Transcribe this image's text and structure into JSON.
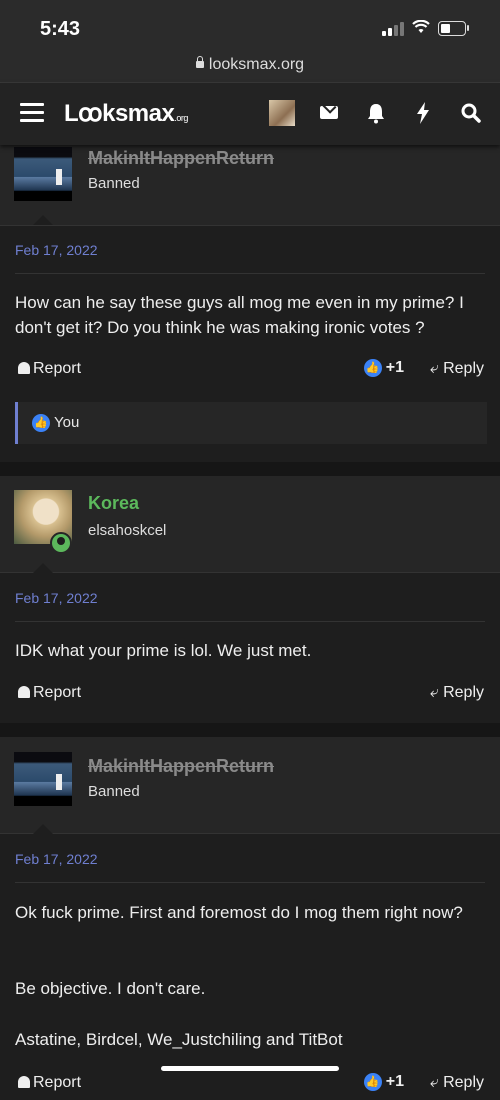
{
  "status": {
    "time": "5:43"
  },
  "browser": {
    "url": "looksmax.org"
  },
  "header": {
    "logo": "Lꝏksmax",
    "logo_suffix": ".org"
  },
  "posts": [
    {
      "username": "MakinItHappenReturn",
      "user_title": "Banned",
      "date": "Feb 17, 2022",
      "message": "How can he say these guys all mog me even in my prime? I don't get it? Do you think he was making ironic votes ?",
      "report_label": "Report",
      "like_count": "+1",
      "reply_label": "Reply",
      "reactions_label": "You"
    },
    {
      "username": "Korea",
      "user_title": "elsahoskcel",
      "date": "Feb 17, 2022",
      "message": "IDK what your prime is lol. We just met.",
      "report_label": "Report",
      "reply_label": "Reply"
    },
    {
      "username": "MakinItHappenReturn",
      "user_title": "Banned",
      "date": "Feb 17, 2022",
      "message_lines": [
        "Ok fuck prime. First and foremost do I mog them right now?",
        "Be objective. I don't care.",
        "Astatine, Birdcel, We_Justchiling and TitBot"
      ],
      "report_label": "Report",
      "like_count": "+1",
      "reply_label": "Reply"
    }
  ],
  "icons": {
    "menu": "hamburger-icon",
    "mail": "envelope-icon",
    "alerts": "bell-icon",
    "whats_new": "bolt-icon",
    "search": "search-icon",
    "like": "thumbs-up-icon",
    "reply": "reply-arrow-icon"
  },
  "colors": {
    "background": "#1e1e1e",
    "header": "#232323",
    "date": "#6f7fd0",
    "online": "#5cb85c",
    "like": "#3b82f6"
  }
}
